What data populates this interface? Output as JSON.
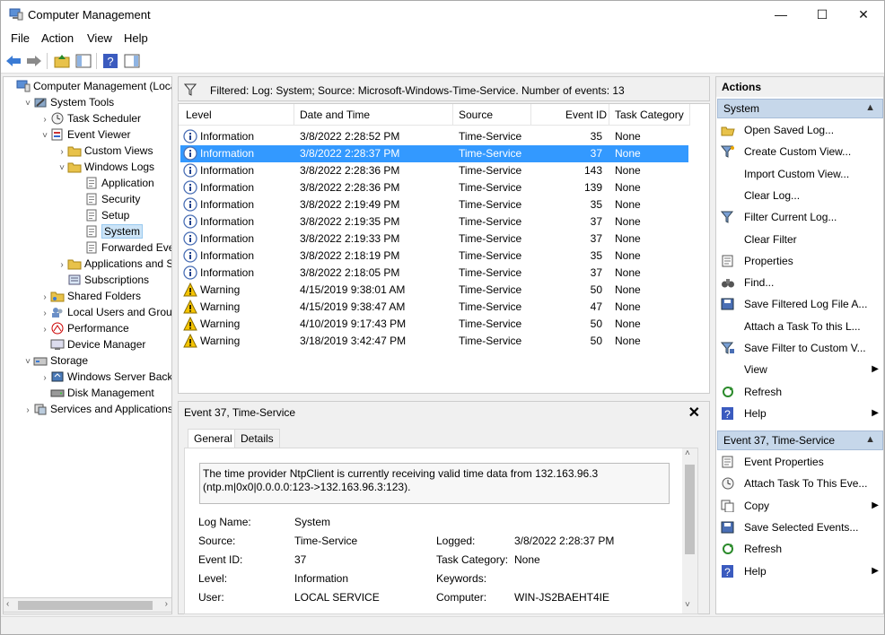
{
  "window": {
    "title": "Computer Management",
    "minimize": "—",
    "maximize": "☐",
    "close": "✕"
  },
  "menu": [
    "File",
    "Action",
    "View",
    "Help"
  ],
  "tree": [
    {
      "label": "Computer Management (Local",
      "depth": 0,
      "exp": "",
      "icon": "computer-icon"
    },
    {
      "label": "System Tools",
      "depth": 1,
      "exp": "˅",
      "icon": "tools-icon"
    },
    {
      "label": "Task Scheduler",
      "depth": 2,
      "exp": "›",
      "icon": "clock-icon"
    },
    {
      "label": "Event Viewer",
      "depth": 2,
      "exp": "˅",
      "icon": "event-viewer-icon"
    },
    {
      "label": "Custom Views",
      "depth": 3,
      "exp": "›",
      "icon": "folder-icon"
    },
    {
      "label": "Windows Logs",
      "depth": 3,
      "exp": "˅",
      "icon": "folder-icon"
    },
    {
      "label": "Application",
      "depth": 4,
      "exp": "",
      "icon": "log-icon"
    },
    {
      "label": "Security",
      "depth": 4,
      "exp": "",
      "icon": "log-icon"
    },
    {
      "label": "Setup",
      "depth": 4,
      "exp": "",
      "icon": "log-icon"
    },
    {
      "label": "System",
      "depth": 4,
      "exp": "",
      "icon": "log-icon",
      "selected": true
    },
    {
      "label": "Forwarded Events",
      "depth": 4,
      "exp": "",
      "icon": "log-icon"
    },
    {
      "label": "Applications and Se",
      "depth": 3,
      "exp": "›",
      "icon": "folder-icon"
    },
    {
      "label": "Subscriptions",
      "depth": 3,
      "exp": "",
      "icon": "subscriptions-icon"
    },
    {
      "label": "Shared Folders",
      "depth": 2,
      "exp": "›",
      "icon": "shared-folder-icon"
    },
    {
      "label": "Local Users and Groups",
      "depth": 2,
      "exp": "›",
      "icon": "users-icon"
    },
    {
      "label": "Performance",
      "depth": 2,
      "exp": "›",
      "icon": "performance-icon"
    },
    {
      "label": "Device Manager",
      "depth": 2,
      "exp": "",
      "icon": "device-manager-icon"
    },
    {
      "label": "Storage",
      "depth": 1,
      "exp": "˅",
      "icon": "storage-icon"
    },
    {
      "label": "Windows Server Backup",
      "depth": 2,
      "exp": "›",
      "icon": "backup-icon"
    },
    {
      "label": "Disk Management",
      "depth": 2,
      "exp": "",
      "icon": "disk-icon"
    },
    {
      "label": "Services and Applications",
      "depth": 1,
      "exp": "›",
      "icon": "services-icon"
    }
  ],
  "filter": {
    "text": "Filtered: Log: System; Source: Microsoft-Windows-Time-Service. Number of events: 13"
  },
  "grid": {
    "columns": [
      "Level",
      "Date and Time",
      "Source",
      "Event ID",
      "Task Category"
    ],
    "rows": [
      {
        "level": "Information",
        "date": "3/8/2022 2:28:52 PM",
        "source": "Time-Service",
        "id": "35",
        "cat": "None",
        "kind": "info"
      },
      {
        "level": "Information",
        "date": "3/8/2022 2:28:37 PM",
        "source": "Time-Service",
        "id": "37",
        "cat": "None",
        "kind": "info",
        "selected": true
      },
      {
        "level": "Information",
        "date": "3/8/2022 2:28:36 PM",
        "source": "Time-Service",
        "id": "143",
        "cat": "None",
        "kind": "info"
      },
      {
        "level": "Information",
        "date": "3/8/2022 2:28:36 PM",
        "source": "Time-Service",
        "id": "139",
        "cat": "None",
        "kind": "info"
      },
      {
        "level": "Information",
        "date": "3/8/2022 2:19:49 PM",
        "source": "Time-Service",
        "id": "35",
        "cat": "None",
        "kind": "info"
      },
      {
        "level": "Information",
        "date": "3/8/2022 2:19:35 PM",
        "source": "Time-Service",
        "id": "37",
        "cat": "None",
        "kind": "info"
      },
      {
        "level": "Information",
        "date": "3/8/2022 2:19:33 PM",
        "source": "Time-Service",
        "id": "37",
        "cat": "None",
        "kind": "info"
      },
      {
        "level": "Information",
        "date": "3/8/2022 2:18:19 PM",
        "source": "Time-Service",
        "id": "35",
        "cat": "None",
        "kind": "info"
      },
      {
        "level": "Information",
        "date": "3/8/2022 2:18:05 PM",
        "source": "Time-Service",
        "id": "37",
        "cat": "None",
        "kind": "info"
      },
      {
        "level": "Warning",
        "date": "4/15/2019 9:38:01 AM",
        "source": "Time-Service",
        "id": "50",
        "cat": "None",
        "kind": "warn"
      },
      {
        "level": "Warning",
        "date": "4/15/2019 9:38:47 AM",
        "source": "Time-Service",
        "id": "47",
        "cat": "None",
        "kind": "warn"
      },
      {
        "level": "Warning",
        "date": "4/10/2019 9:17:43 PM",
        "source": "Time-Service",
        "id": "50",
        "cat": "None",
        "kind": "warn"
      },
      {
        "level": "Warning",
        "date": "3/18/2019 3:42:47 PM",
        "source": "Time-Service",
        "id": "50",
        "cat": "None",
        "kind": "warn"
      }
    ]
  },
  "detail": {
    "title": "Event 37, Time-Service",
    "close": "✕",
    "tabs": [
      "General",
      "Details"
    ],
    "message": "The time provider NtpClient is currently receiving valid time data from 132.163.96.3 (ntp.m|0x0|0.0.0.0:123->132.163.96.3:123).",
    "fields": {
      "log_name_label": "Log Name:",
      "log_name": "System",
      "source_label": "Source:",
      "source": "Time-Service",
      "logged_label": "Logged:",
      "logged": "3/8/2022 2:28:37 PM",
      "event_id_label": "Event ID:",
      "event_id": "37",
      "task_cat_label": "Task Category:",
      "task_cat": "None",
      "level_label": "Level:",
      "level": "Information",
      "keywords_label": "Keywords:",
      "keywords": "",
      "user_label": "User:",
      "user": "LOCAL SERVICE",
      "computer_label": "Computer:",
      "computer": "WIN-JS2BAEHT4IE"
    }
  },
  "actions": {
    "header": "Actions",
    "section1": "System",
    "items1": [
      {
        "label": "Open Saved Log...",
        "icon": "open-folder-icon",
        "sub": false
      },
      {
        "label": "Create Custom View...",
        "icon": "filter-star-icon",
        "sub": false
      },
      {
        "label": "Import Custom View...",
        "icon": "",
        "sub": false
      },
      {
        "label": "Clear Log...",
        "icon": "",
        "sub": false
      },
      {
        "label": "Filter Current Log...",
        "icon": "filter-icon",
        "sub": false
      },
      {
        "label": "Clear Filter",
        "icon": "",
        "sub": false
      },
      {
        "label": "Properties",
        "icon": "properties-icon",
        "sub": false
      },
      {
        "label": "Find...",
        "icon": "binoculars-icon",
        "sub": false
      },
      {
        "label": "Save Filtered Log File A...",
        "icon": "save-icon",
        "sub": false
      },
      {
        "label": "Attach a Task To this L...",
        "icon": "",
        "sub": false
      },
      {
        "label": "Save Filter to Custom V...",
        "icon": "filter-save-icon",
        "sub": false
      },
      {
        "label": "View",
        "icon": "",
        "sub": true
      },
      {
        "label": "Refresh",
        "icon": "refresh-icon",
        "sub": false
      },
      {
        "label": "Help",
        "icon": "help-icon",
        "sub": true
      }
    ],
    "section2": "Event 37, Time-Service",
    "items2": [
      {
        "label": "Event Properties",
        "icon": "properties-icon",
        "sub": false
      },
      {
        "label": "Attach Task To This Eve...",
        "icon": "attach-task-icon",
        "sub": false
      },
      {
        "label": "Copy",
        "icon": "copy-icon",
        "sub": true
      },
      {
        "label": "Save Selected Events...",
        "icon": "save-icon",
        "sub": false
      },
      {
        "label": "Refresh",
        "icon": "refresh-icon",
        "sub": false
      },
      {
        "label": "Help",
        "icon": "help-icon",
        "sub": true
      }
    ]
  }
}
